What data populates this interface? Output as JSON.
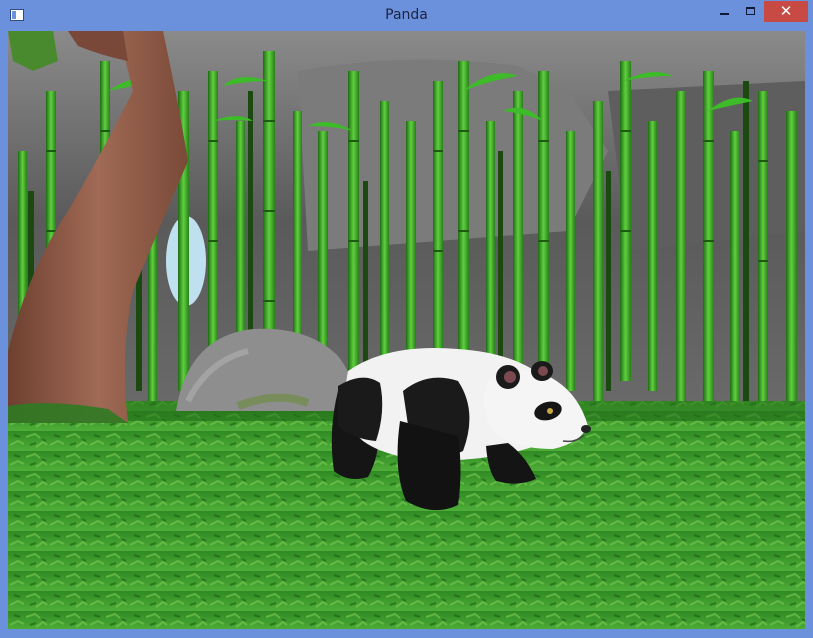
{
  "window": {
    "title": "Panda",
    "icon": "app-window-icon",
    "controls": {
      "minimize_icon": "minimize-icon",
      "maximize_icon": "maximize-icon",
      "close_glyph": "✕",
      "close_color": "#c74a45"
    }
  },
  "scene": {
    "description_colors": {
      "sky": "#6e6e6e",
      "bamboo": "#3fae2a",
      "grass": "#3c9a2c",
      "tree_trunk": "#8b5a45",
      "rock": "#8d8d8d"
    }
  }
}
